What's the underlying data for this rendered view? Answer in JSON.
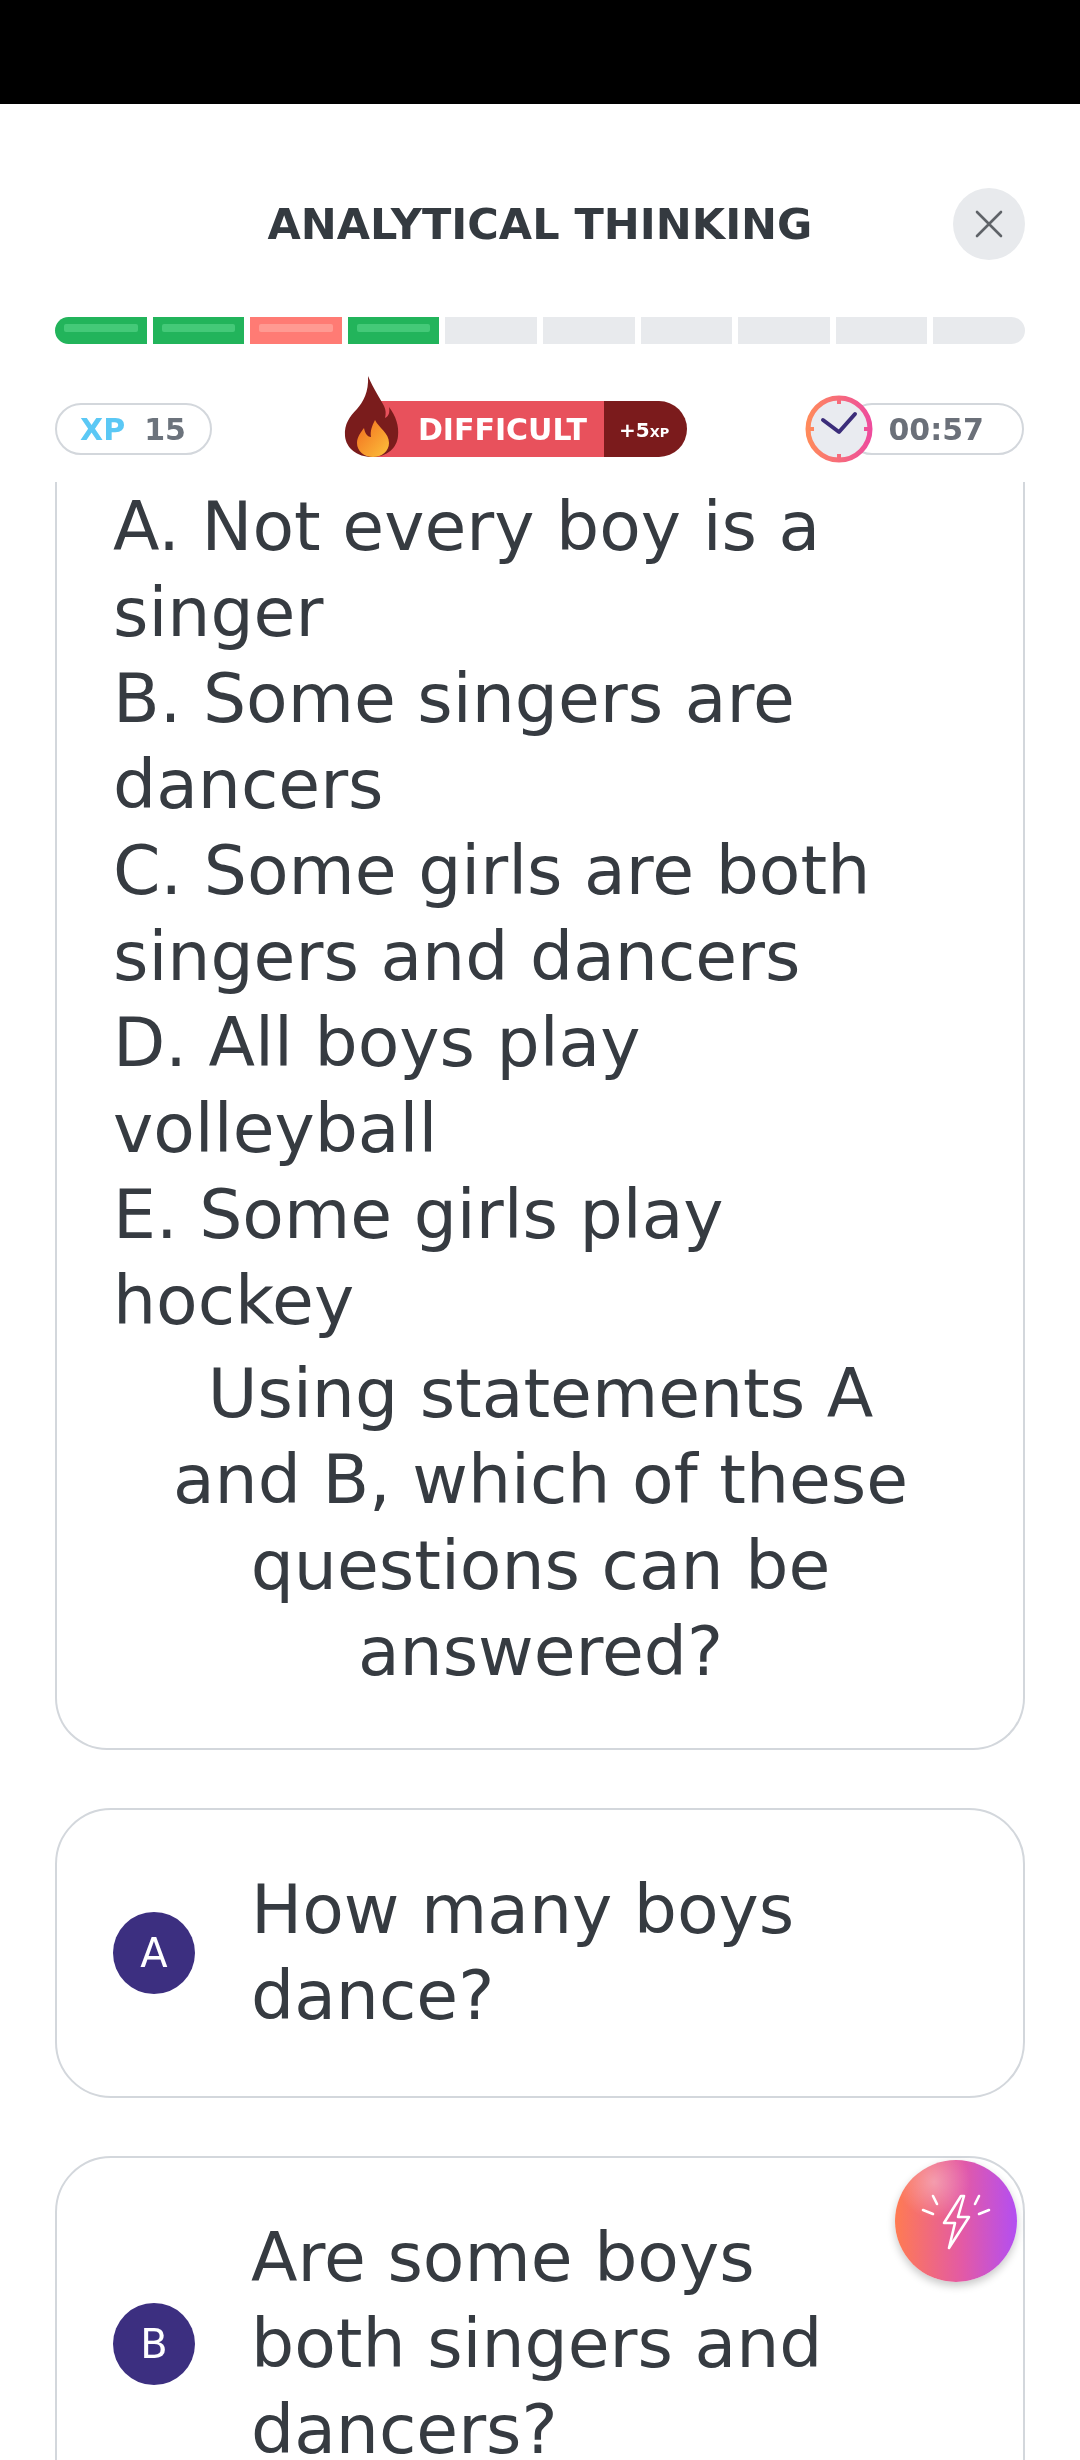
{
  "title": "ANALYTICAL THINKING",
  "progress": [
    {
      "kind": "correct"
    },
    {
      "kind": "correct"
    },
    {
      "kind": "wrong"
    },
    {
      "kind": "correct"
    },
    {
      "kind": "empty"
    },
    {
      "kind": "empty"
    },
    {
      "kind": "empty"
    },
    {
      "kind": "empty"
    },
    {
      "kind": "empty"
    },
    {
      "kind": "empty"
    }
  ],
  "xp": {
    "label": "XP",
    "value": "15"
  },
  "difficulty": {
    "label": "DIFFICULT",
    "bonus_amount": "+5",
    "bonus_unit": "XP"
  },
  "timer": {
    "time": "00:57"
  },
  "question_card": {
    "statements": [
      "A. Not every boy is a singer",
      "B. Some singers are dancers",
      "C. Some girls are both singers and dancers",
      "D. All boys play volleyball",
      "E. Some girls play hockey"
    ],
    "question": "Using statements A and B, which of these questions can be answered?"
  },
  "options": [
    {
      "letter": "A",
      "text": "How many boys dance?",
      "selected": false
    },
    {
      "letter": "B",
      "text": "Are some boys both singers and dancers?",
      "selected": false
    }
  ]
}
